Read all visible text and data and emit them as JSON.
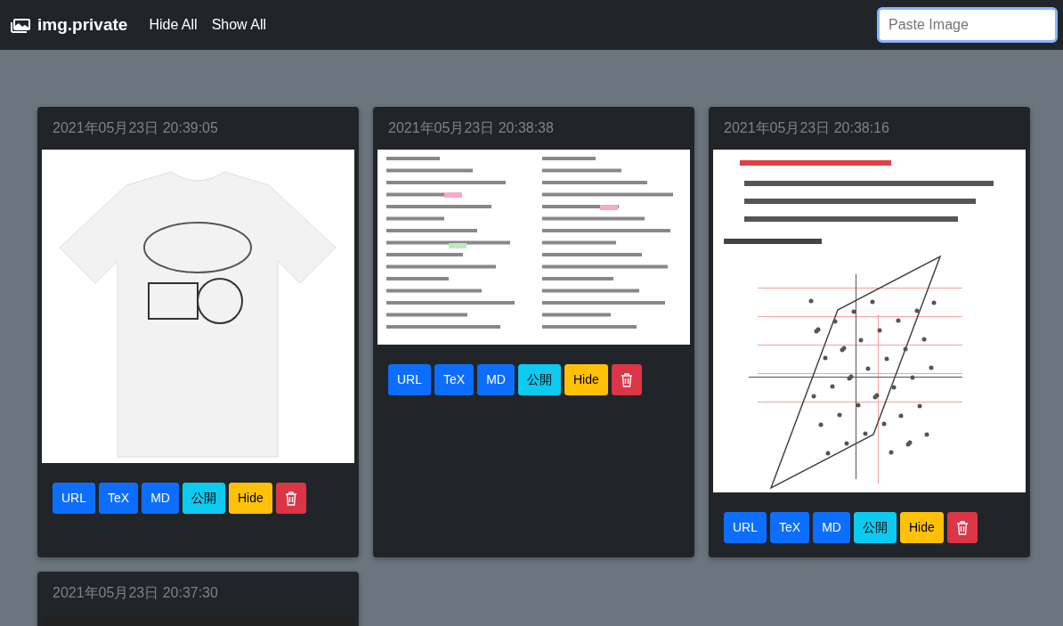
{
  "navbar": {
    "brand": "img.private",
    "links": [
      "Hide All",
      "Show All"
    ],
    "paste": {
      "placeholder": "Paste Image"
    }
  },
  "cards": [
    {
      "timestamp": "2021年05月23日 20:39:05",
      "buttons": [
        {
          "kind": "primary",
          "label": "URL"
        },
        {
          "kind": "primary",
          "label": "TeX"
        },
        {
          "kind": "primary",
          "label": "MD"
        },
        {
          "kind": "info",
          "label": "公開"
        },
        {
          "kind": "warning",
          "label": "Hide"
        },
        {
          "kind": "delete"
        }
      ]
    },
    {
      "timestamp": "2021年05月23日 20:38:38",
      "buttons": [
        {
          "kind": "primary",
          "label": "URL"
        },
        {
          "kind": "primary",
          "label": "TeX"
        },
        {
          "kind": "primary",
          "label": "MD"
        },
        {
          "kind": "info",
          "label": "公開"
        },
        {
          "kind": "warning",
          "label": "Hide"
        },
        {
          "kind": "delete"
        }
      ]
    },
    {
      "timestamp": "2021年05月23日 20:38:16",
      "buttons": [
        {
          "kind": "primary",
          "label": "URL"
        },
        {
          "kind": "primary",
          "label": "TeX"
        },
        {
          "kind": "primary",
          "label": "MD"
        },
        {
          "kind": "info",
          "label": "公開"
        },
        {
          "kind": "warning",
          "label": "Hide"
        },
        {
          "kind": "delete"
        }
      ]
    },
    {
      "timestamp": "2021年05月23日 20:37:30"
    }
  ]
}
